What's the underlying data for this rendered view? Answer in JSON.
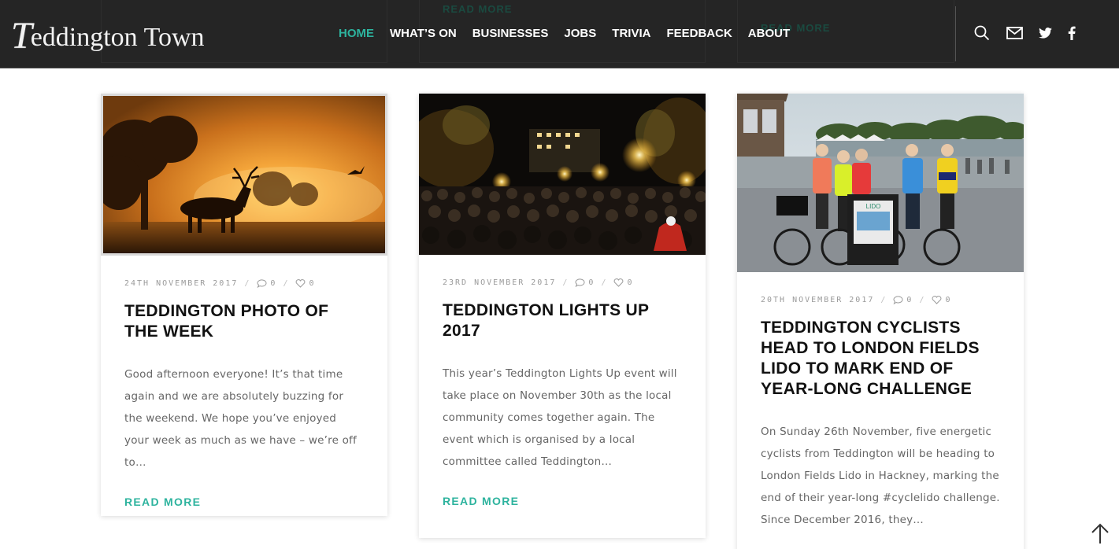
{
  "site": {
    "logo_initial": "T",
    "logo_rest": "eddington Town"
  },
  "nav": {
    "items": [
      {
        "label": "HOME",
        "active": true
      },
      {
        "label": "WHAT’S ON"
      },
      {
        "label": "BUSINESSES"
      },
      {
        "label": "JOBS"
      },
      {
        "label": "TRIVIA"
      },
      {
        "label": "FEEDBACK"
      },
      {
        "label": "ABOUT"
      }
    ]
  },
  "header_icons": [
    "search-icon",
    "mail-icon",
    "twitter-icon",
    "facebook-icon"
  ],
  "ghost_links": {
    "middle": "READ MORE",
    "right": "READ MORE"
  },
  "posts": [
    {
      "date": "24TH NOVEMBER 2017",
      "comments": "0",
      "likes": "0",
      "title": "TEDDINGTON PHOTO OF THE WEEK",
      "excerpt": "Good afternoon everyone! It’s that time again and we are absolutely buzzing for the weekend. We hope you’ve enjoyed your week as much as we have – we’re off to…",
      "read_more": "READ MORE"
    },
    {
      "date": "23RD NOVEMBER 2017",
      "comments": "0",
      "likes": "0",
      "title": "TEDDINGTON LIGHTS UP 2017",
      "excerpt": "This year’s Teddington Lights Up event will take place on November 30th as the local community comes together again. The event which is organised by a local committee called Teddington…",
      "read_more": "READ MORE"
    },
    {
      "date": "20TH NOVEMBER 2017",
      "comments": "0",
      "likes": "0",
      "title": "TEDDINGTON CYCLISTS HEAD TO LONDON FIELDS LIDO TO MARK END OF YEAR-LONG CHALLENGE",
      "excerpt": "On Sunday 26th November, five energetic cyclists from Teddington will be heading to London Fields Lido in Hackney, marking the end of their year-long #cyclelido challenge. Since December 2016, they…",
      "sign_text": "LIDO"
    }
  ],
  "colors": {
    "accent": "#2db39e",
    "header_bg": "#1e1e1e"
  }
}
